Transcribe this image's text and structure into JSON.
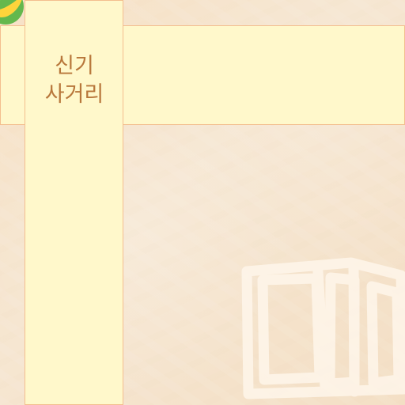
{
  "map": {
    "junction_label": "신기\n사거리",
    "colors": {
      "background": "#f6e3cc",
      "road_fill": "#fff8cb",
      "road_border": "#f3be8e",
      "label": "#b8773b",
      "building_outline": "#fff7ec",
      "marker_green": "#64b84d",
      "marker_yellow": "#ffd43b"
    },
    "icons": {
      "poi_marker": "poi-marker-icon",
      "building": "building-outline-icon"
    }
  }
}
